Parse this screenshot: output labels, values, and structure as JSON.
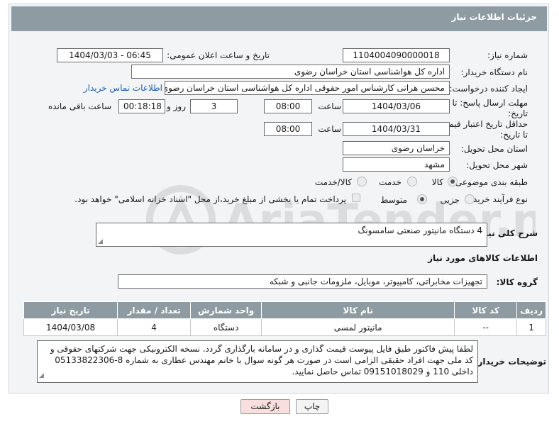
{
  "header": {
    "title": "جزئیات اطلاعات نیاز"
  },
  "form": {
    "need_number_label": "شماره نیاز:",
    "need_number": "1104004090000018",
    "announce_label": "تاریخ و ساعت اعلان عمومی:",
    "announce_value": "1404/03/03 - 06:45",
    "buyer_org_label": "نام دستگاه خریدار:",
    "buyer_org": "اداره کل هواشناسی استان خراسان رضوی",
    "requester_label": "ایجاد کننده درخواست:",
    "requester": "محسن هراتی کارشناس امور حقوقی اداره کل هواشناسی استان خراسان رضوی",
    "contact_link": "اطلاعات تماس خریدار",
    "deadline_label": "مهلت ارسال پاسخ: تا تاریخ:",
    "deadline_date": "1404/03/06",
    "time_label": "ساعت",
    "deadline_time": "08:00",
    "days_value": "3",
    "days_label": "روز و",
    "remaining_time": "00:18:18",
    "remaining_label": "ساعت باقی مانده",
    "price_validity_label": "حداقل تاریخ اعتبار قیمت: تا تاریخ:",
    "price_validity_date": "1404/03/31",
    "price_validity_time": "08:00",
    "province_label": "استان محل تحویل:",
    "province": "خراسان رضوی",
    "city_label": "شهر محل تحویل:",
    "city": "مشهد",
    "category_label": "طبقه بندی موضوعی:",
    "category_options": [
      "کالا",
      "خدمت",
      "کالا/خدمت"
    ],
    "category_selected": "کالا",
    "process_label": "نوع فرآیند خرید :",
    "process_options": [
      "جزیی",
      "متوسط"
    ],
    "process_selected": "متوسط",
    "payment_note": "پرداخت تمام یا بخشی از مبلغ خرید،از محل \"اسناد خزانه اسلامی\" خواهد بود."
  },
  "description": {
    "label": "شرح کلی نیاز:",
    "value": "4 دستگاه مانیتور صنعتی سامسونگ"
  },
  "goods_section": {
    "title": "اطلاعات کالاهای مورد نیاز",
    "group_label": "گروه کالا:",
    "group_value": "تجهیزات مخابراتی، کامپیوتر، موبایل، ملزومات جانبی و شبکه"
  },
  "table": {
    "headers": [
      "ردیف",
      "کد کالا",
      "نام کالا",
      "واحد شمارش",
      "تعداد / مقدار",
      "تاریخ نیاز"
    ],
    "rows": [
      [
        "1",
        "--",
        "مانیتور لمسی",
        "دستگاه",
        "4",
        "1404/03/08"
      ]
    ]
  },
  "buyer_notes": {
    "label": "توضیحات خریدار:",
    "text": "لطفا پیش فاکتور طبق فایل پیوست قیمت گذاری  و در سامانه بارگذاری گردد. نسخه الکترونیکی جهت شرکتهای حقوقی و کد ملی جهت افراد حقیقی الزامی است در صورت هر گونه سوال با خانم مهندس عطاری به شماره 8-05133822306 داخلی 110 و 09151018029 تماس حاصل نمایید."
  },
  "buttons": {
    "print": "چاپ",
    "back": "بازگشت"
  },
  "colors": {
    "header_bg": "#8e9ba3",
    "panel_bg": "#f3f4f6",
    "link": "#1f5fae",
    "back_button_bg": "#f9dede"
  }
}
